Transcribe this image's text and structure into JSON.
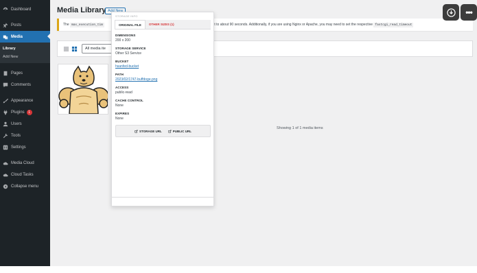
{
  "sidebar": {
    "items": [
      {
        "label": "Dashboard",
        "icon": "dashboard-icon"
      },
      {
        "label": "Posts",
        "icon": "pin-icon"
      },
      {
        "label": "Media",
        "icon": "media-icon",
        "current": true
      },
      {
        "label": "Pages",
        "icon": "page-icon"
      },
      {
        "label": "Comments",
        "icon": "comment-icon"
      },
      {
        "label": "Appearance",
        "icon": "brush-icon"
      },
      {
        "label": "Plugins",
        "icon": "plug-icon",
        "badge": "1"
      },
      {
        "label": "Users",
        "icon": "user-icon"
      },
      {
        "label": "Tools",
        "icon": "wrench-icon"
      },
      {
        "label": "Settings",
        "icon": "settings-icon"
      },
      {
        "label": "Media Cloud",
        "icon": "cloud-icon"
      },
      {
        "label": "Cloud Tasks",
        "icon": "tasks-icon"
      },
      {
        "label": "Collapse menu",
        "icon": "collapse-icon"
      }
    ],
    "submenu": [
      "Library",
      "Add New"
    ]
  },
  "header": {
    "title": "Media Library",
    "add_new": "Add New"
  },
  "notice": {
    "prefix": "The",
    "code1": "max_execution_tim",
    "text": "ld set it to about 90 seconds. Additionally, if you are using Nginx or Apache, you may need to set the respective",
    "code2": "fastcgi_read_timeout"
  },
  "toolbar": {
    "filter_value": "All media ite"
  },
  "status": {
    "showing": "Showing 1 of 1 media items"
  },
  "popup": {
    "header": "STORAGE INFO",
    "tabs": [
      "ORIGINAL FILE",
      "OTHER SIZES (1)"
    ],
    "fields": {
      "dimensions": {
        "label": "DIMENSIONS",
        "value": "200 x 200"
      },
      "service": {
        "label": "STORAGE SERVICE",
        "value": "Other S3 Service"
      },
      "bucket": {
        "label": "BUCKET",
        "value": "hsanfed-bucket"
      },
      "path": {
        "label": "PATH",
        "value": "2023/02/1747-buffdoge.png"
      },
      "access": {
        "label": "ACCESS",
        "value": "public-read"
      },
      "cache": {
        "label": "CACHE CONTROL",
        "value": "None"
      },
      "expires": {
        "label": "EXPIRES",
        "value": "None"
      }
    },
    "buttons": [
      "STORAGE URL",
      "PUBLIC URL"
    ]
  },
  "colors": {
    "sidebar_bg": "#1d2327",
    "accent": "#2271b1",
    "danger": "#d63638",
    "warning": "#dba617"
  }
}
